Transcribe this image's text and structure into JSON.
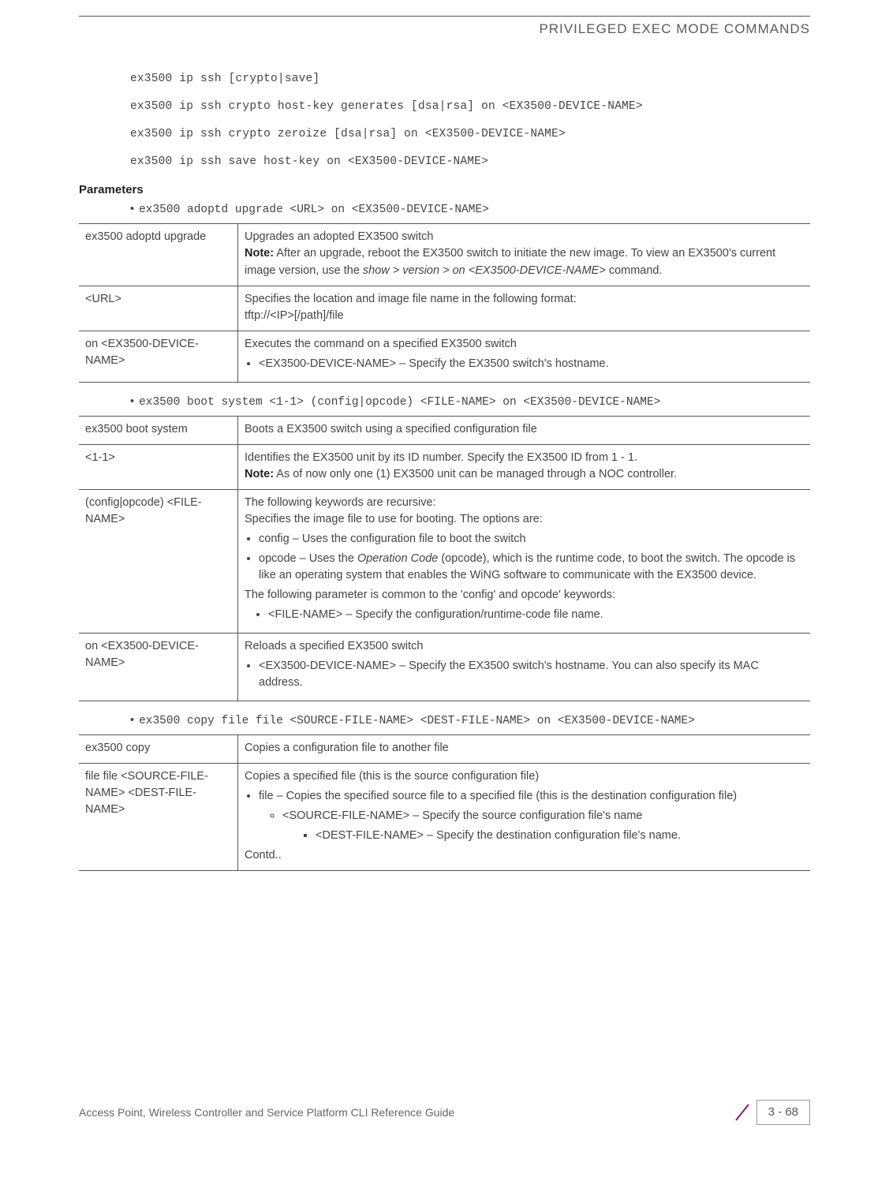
{
  "header": {
    "title": "PRIVILEGED EXEC MODE COMMANDS"
  },
  "syntax": {
    "l1": "ex3500 ip ssh [crypto|save]",
    "l2": "ex3500 ip ssh crypto host-key generates [dsa|rsa] on <EX3500-DEVICE-NAME>",
    "l3": "ex3500 ip ssh crypto zeroize [dsa|rsa] on <EX3500-DEVICE-NAME>",
    "l4": "ex3500 ip ssh save host-key on <EX3500-DEVICE-NAME>"
  },
  "parameters_heading": "Parameters",
  "bullets": {
    "b1": "ex3500 adoptd upgrade <URL> on <EX3500-DEVICE-NAME>",
    "b2": "ex3500 boot system <1-1> (config|opcode) <FILE-NAME> on <EX3500-DEVICE-NAME>",
    "b3": "ex3500 copy file file <SOURCE-FILE-NAME> <DEST-FILE-NAME> on <EX3500-DEVICE-NAME>"
  },
  "t1": {
    "r1": {
      "left": "ex3500 adoptd upgrade",
      "p1": "Upgrades an adopted EX3500 switch",
      "note_pre": "Note:",
      "note_txt": " After an upgrade, reboot the EX3500 switch to initiate the new image. To view an EX3500's current image version, use the ",
      "note_it": "show > version > on <EX3500-DEVICE-NAME>",
      "note_post": " command."
    },
    "r2": {
      "left": "<URL>",
      "p1": "Specifies the location and image file name in the following format:",
      "p2": "tftp://<IP>[/path]/file"
    },
    "r3": {
      "left": "on <EX3500-DEVICE-NAME>",
      "p1": "Executes the command on a specified EX3500 switch",
      "li1": "<EX3500-DEVICE-NAME> – Specify the EX3500 switch's hostname."
    }
  },
  "t2": {
    "r1": {
      "left": "ex3500 boot system",
      "p1": "Boots a EX3500 switch using a specified configuration file"
    },
    "r2": {
      "left": "<1-1>",
      "p1": "Identifies the EX3500 unit by its ID number. Specify the EX3500 ID from 1 - 1.",
      "note_pre": "Note:",
      "note_txt": " As of now only one (1) EX3500 unit can be managed through a NOC controller."
    },
    "r3": {
      "left": "(config|opcode) <FILE-NAME>",
      "p1": "The following keywords are recursive:",
      "p2": "Specifies the image file to use for booting. The options are:",
      "li1": "config – Uses the configuration file to boot the switch",
      "li2a": "opcode – Uses the ",
      "li2b": "Operation Code",
      "li2c": " (opcode), which is the runtime code, to boot the switch. The opcode is like an operating system that enables the WiNG software to communicate with the EX3500 device.",
      "p3": "The following parameter is common to the 'config' and opcode' keywords:",
      "li3": "<FILE-NAME> – Specify the configuration/runtime-code file name."
    },
    "r4": {
      "left": "on <EX3500-DEVICE-NAME>",
      "p1": "Reloads a specified EX3500 switch",
      "li1": "<EX3500-DEVICE-NAME> – Specify the EX3500 switch's hostname. You can also specify its MAC address."
    }
  },
  "t3": {
    "r1": {
      "left": "ex3500 copy",
      "p1": "Copies a configuration file to another file"
    },
    "r2": {
      "left": "file file <SOURCE-FILE-NAME> <DEST-FILE-NAME>",
      "p1": "Copies a specified file (this is the source configuration file)",
      "li1": "file – Copies the specified source file to a specified file (this is the destination configuration file)",
      "li2": "<SOURCE-FILE-NAME> – Specify the source configuration file's name",
      "li3": "<DEST-FILE-NAME> – Specify the destination configuration file's name.",
      "p2": "Contd.."
    }
  },
  "footer": {
    "left": "Access Point, Wireless Controller and Service Platform CLI Reference Guide",
    "page": "3 - 68"
  }
}
